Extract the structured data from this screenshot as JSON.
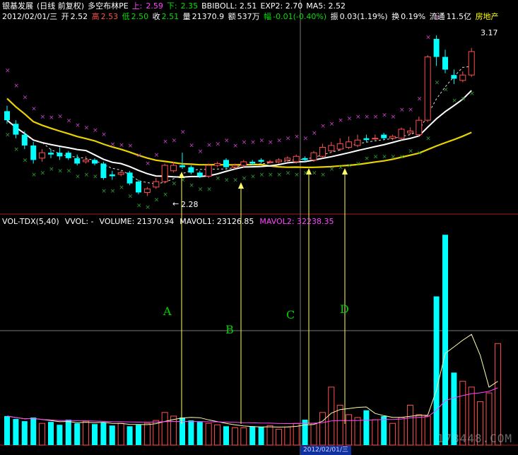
{
  "header": {
    "stock_name": "银基发展",
    "period": "(日线 前复权)",
    "indicator": "多空布林PE",
    "up_label": "上:",
    "up_value": "2.59",
    "down_label": "下:",
    "down_value": "2.35",
    "bbiboll": "BBIBOLL: 2.51",
    "exp2": "EXP2: 2.70",
    "ma5": "MA5: 2.52"
  },
  "quote": {
    "date": "2012/02/01/三",
    "open_label": "开",
    "open": "2.52",
    "high_label": "高",
    "high": "2.53",
    "low_label": "低",
    "low": "2.50",
    "close_label": "收",
    "close": "2.51",
    "volume_label": "量",
    "volume": "21370.9",
    "amount_label": "额",
    "amount": "537万",
    "change_label": "幅",
    "change": "-0.01(-0.40%)",
    "amplitude_label": "振",
    "amplitude": "0.03(1.19%)",
    "turnover_label": "换",
    "turnover": "0.19%",
    "float_label": "流通",
    "float": "11.5亿",
    "sector": "房地产"
  },
  "price_marks": {
    "high_mark": "3.17",
    "low_mark": "2.28"
  },
  "volume_panel": {
    "name": "VOL-TDX(5,40)",
    "vvol": "VVOL: -",
    "volume": "VOLUME: 21370.94",
    "mavol1": "MAVOL1: 23126.85",
    "mavol2": "MAVOL2: 32238.35"
  },
  "annotations": {
    "a": "A",
    "b": "B",
    "c": "C",
    "d": "D"
  },
  "footer": {
    "date_box": "2012/02/01/三"
  },
  "watermark": "178448.COM",
  "colors": {
    "background": "#000000",
    "up_candle": "#ff5050",
    "down_candle": "#00ffff",
    "ma_white": "#ffffff",
    "ma_yellow": "#e8d200",
    "sar_upper": "#cc44cc",
    "sar_lower": "#30a030",
    "arrow": "#ffff66",
    "mavol1": "#ffffaa",
    "mavol2": "#ff44ff"
  },
  "candles": [
    {
      "o": 2.75,
      "c": 2.7,
      "h": 2.78,
      "l": 2.68
    },
    {
      "o": 2.68,
      "c": 2.62,
      "h": 2.7,
      "l": 2.6
    },
    {
      "o": 2.62,
      "c": 2.56,
      "h": 2.64,
      "l": 2.54
    },
    {
      "o": 2.56,
      "c": 2.48,
      "h": 2.58,
      "l": 2.46
    },
    {
      "o": 2.49,
      "c": 2.52,
      "h": 2.54,
      "l": 2.47
    },
    {
      "o": 2.52,
      "c": 2.51,
      "h": 2.54,
      "l": 2.49
    },
    {
      "o": 2.52,
      "c": 2.5,
      "h": 2.55,
      "l": 2.48
    },
    {
      "o": 2.52,
      "c": 2.49,
      "h": 2.53,
      "l": 2.48
    },
    {
      "o": 2.49,
      "c": 2.46,
      "h": 2.51,
      "l": 2.45
    },
    {
      "o": 2.47,
      "c": 2.48,
      "h": 2.5,
      "l": 2.46
    },
    {
      "o": 2.48,
      "c": 2.46,
      "h": 2.49,
      "l": 2.45
    },
    {
      "o": 2.46,
      "c": 2.38,
      "h": 2.47,
      "l": 2.37
    },
    {
      "o": 2.4,
      "c": 2.39,
      "h": 2.42,
      "l": 2.37
    },
    {
      "o": 2.4,
      "c": 2.41,
      "h": 2.42,
      "l": 2.39
    },
    {
      "o": 2.41,
      "c": 2.35,
      "h": 2.42,
      "l": 2.34
    },
    {
      "o": 2.36,
      "c": 2.3,
      "h": 2.37,
      "l": 2.29
    },
    {
      "o": 2.3,
      "c": 2.32,
      "h": 2.33,
      "l": 2.28
    },
    {
      "o": 2.33,
      "c": 2.36,
      "h": 2.38,
      "l": 2.32
    },
    {
      "o": 2.36,
      "c": 2.45,
      "h": 2.46,
      "l": 2.35
    },
    {
      "o": 2.42,
      "c": 2.45,
      "h": 2.47,
      "l": 2.41
    },
    {
      "o": 2.45,
      "c": 2.44,
      "h": 2.52,
      "l": 2.43
    },
    {
      "o": 2.44,
      "c": 2.41,
      "h": 2.45,
      "l": 2.4
    },
    {
      "o": 2.41,
      "c": 2.39,
      "h": 2.42,
      "l": 2.38
    },
    {
      "o": 2.39,
      "c": 2.45,
      "h": 2.46,
      "l": 2.38
    },
    {
      "o": 2.45,
      "c": 2.46,
      "h": 2.47,
      "l": 2.44
    },
    {
      "o": 2.48,
      "c": 2.44,
      "h": 2.49,
      "l": 2.43
    },
    {
      "o": 2.44,
      "c": 2.45,
      "h": 2.46,
      "l": 2.43
    },
    {
      "o": 2.45,
      "c": 2.47,
      "h": 2.48,
      "l": 2.44
    },
    {
      "o": 2.47,
      "c": 2.46,
      "h": 2.48,
      "l": 2.45
    },
    {
      "o": 2.48,
      "c": 2.47,
      "h": 2.49,
      "l": 2.46
    },
    {
      "o": 2.47,
      "c": 2.47,
      "h": 2.48,
      "l": 2.46
    },
    {
      "o": 2.47,
      "c": 2.48,
      "h": 2.49,
      "l": 2.46
    },
    {
      "o": 2.48,
      "c": 2.49,
      "h": 2.5,
      "l": 2.47
    },
    {
      "o": 2.47,
      "c": 2.5,
      "h": 2.51,
      "l": 2.46
    },
    {
      "o": 2.49,
      "c": 2.48,
      "h": 2.5,
      "l": 2.47
    },
    {
      "o": 2.48,
      "c": 2.52,
      "h": 2.53,
      "l": 2.47
    },
    {
      "o": 2.5,
      "c": 2.55,
      "h": 2.57,
      "l": 2.49
    },
    {
      "o": 2.53,
      "c": 2.56,
      "h": 2.58,
      "l": 2.52
    },
    {
      "o": 2.54,
      "c": 2.57,
      "h": 2.6,
      "l": 2.53
    },
    {
      "o": 2.55,
      "c": 2.58,
      "h": 2.61,
      "l": 2.54
    },
    {
      "o": 2.56,
      "c": 2.59,
      "h": 2.62,
      "l": 2.55
    },
    {
      "o": 2.6,
      "c": 2.59,
      "h": 2.62,
      "l": 2.58
    },
    {
      "o": 2.6,
      "c": 2.6,
      "h": 2.62,
      "l": 2.59
    },
    {
      "o": 2.62,
      "c": 2.6,
      "h": 2.63,
      "l": 2.59
    },
    {
      "o": 2.6,
      "c": 2.61,
      "h": 2.62,
      "l": 2.59
    },
    {
      "o": 2.6,
      "c": 2.65,
      "h": 2.66,
      "l": 2.59
    },
    {
      "o": 2.63,
      "c": 2.64,
      "h": 2.66,
      "l": 2.62
    },
    {
      "o": 2.62,
      "c": 2.7,
      "h": 2.72,
      "l": 2.61
    },
    {
      "o": 2.7,
      "c": 3.05,
      "h": 3.06,
      "l": 2.69
    },
    {
      "o": 3.15,
      "c": 3.05,
      "h": 3.17,
      "l": 3.0
    },
    {
      "o": 3.05,
      "c": 2.98,
      "h": 3.09,
      "l": 2.96
    },
    {
      "o": 2.95,
      "c": 2.93,
      "h": 2.98,
      "l": 2.9
    },
    {
      "o": 2.92,
      "c": 2.95,
      "h": 2.97,
      "l": 2.91
    },
    {
      "o": 2.95,
      "c": 3.08,
      "h": 3.1,
      "l": 2.94
    }
  ],
  "volumes": [
    40,
    36,
    33,
    38,
    30,
    32,
    28,
    35,
    30,
    33,
    29,
    31,
    27,
    30,
    26,
    28,
    30,
    34,
    45,
    40,
    38,
    34,
    32,
    30,
    28,
    26,
    24,
    24,
    26,
    25,
    27,
    22,
    25,
    30,
    35,
    30,
    45,
    80,
    55,
    42,
    38,
    48,
    35,
    40,
    30,
    38,
    55,
    42,
    40,
    205,
    290,
    100,
    88,
    80,
    60,
    72,
    140
  ]
}
